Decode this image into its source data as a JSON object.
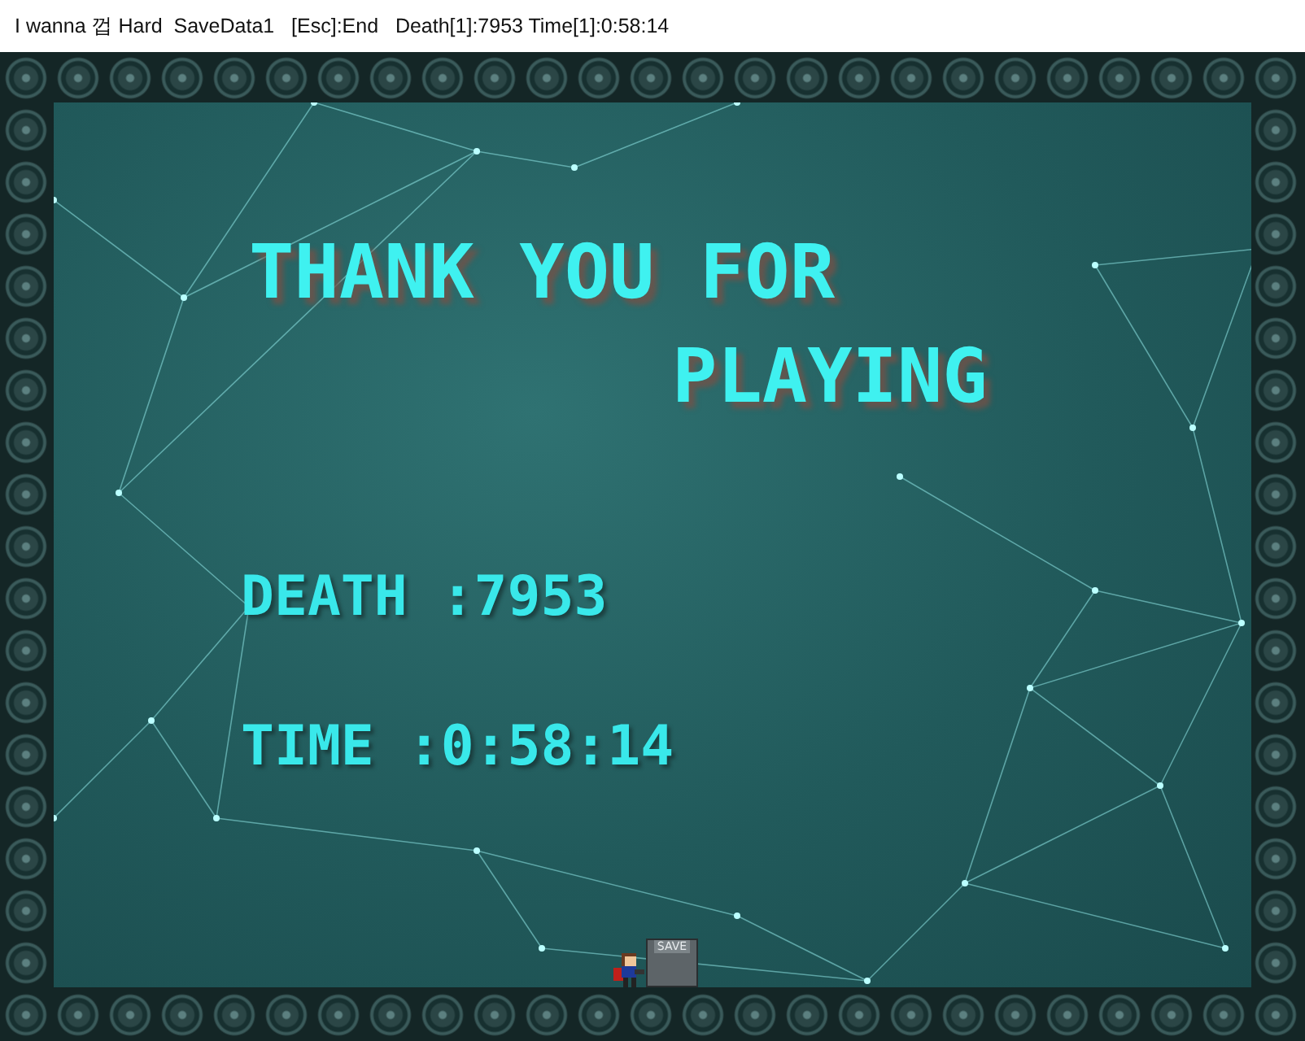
{
  "window": {
    "title": "I wanna 껍 Hard  SaveData1   [Esc]:End   Death[1]:7953 Time[1]:0:58:14"
  },
  "game": {
    "heading_lines": [
      "THANK YOU FOR",
      "PLAYING"
    ],
    "stats": [
      {
        "label": "DEATH :7953"
      },
      {
        "label": "TIME :0:58:14"
      }
    ],
    "save_point": {
      "label": "SAVE"
    }
  }
}
